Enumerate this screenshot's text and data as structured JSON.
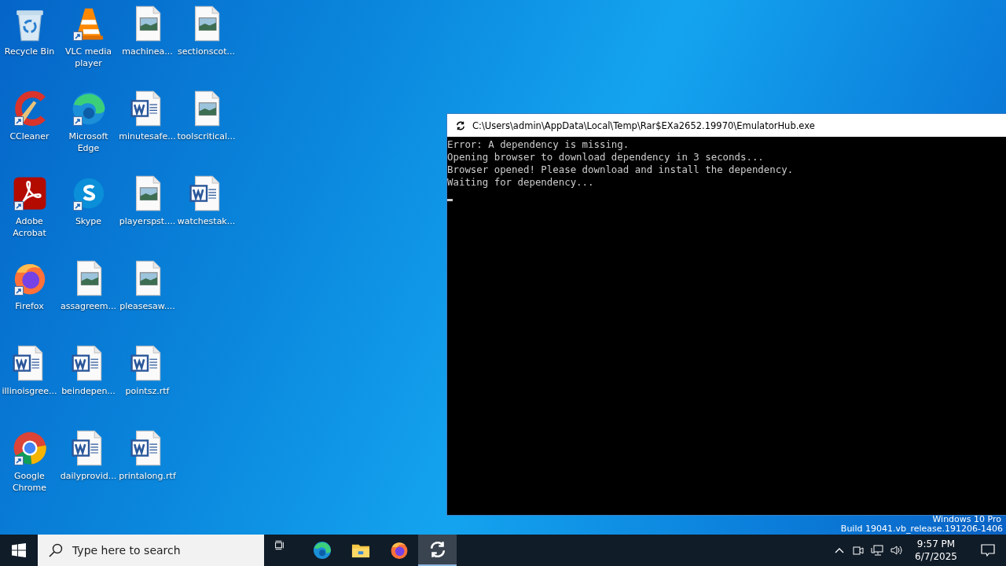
{
  "desktop": {
    "icons": [
      {
        "label": "Recycle Bin",
        "kind": "recycle",
        "shortcut": false
      },
      {
        "label": "CCleaner",
        "kind": "ccleaner",
        "shortcut": true
      },
      {
        "label": "Adobe Acrobat",
        "kind": "acrobat",
        "shortcut": true
      },
      {
        "label": "Firefox",
        "kind": "firefox",
        "shortcut": true
      },
      {
        "label": "illinoisgree...",
        "kind": "word",
        "shortcut": false
      },
      {
        "label": "Google Chrome",
        "kind": "chrome",
        "shortcut": true
      },
      {
        "label": "VLC media player",
        "kind": "vlc",
        "shortcut": true
      },
      {
        "label": "Microsoft Edge",
        "kind": "edge",
        "shortcut": true
      },
      {
        "label": "Skype",
        "kind": "skype",
        "shortcut": true
      },
      {
        "label": "assagreem...",
        "kind": "image",
        "shortcut": false
      },
      {
        "label": "beindepen...",
        "kind": "word",
        "shortcut": false
      },
      {
        "label": "dailyprovid...",
        "kind": "word",
        "shortcut": false
      },
      {
        "label": "machinea...",
        "kind": "image",
        "shortcut": false
      },
      {
        "label": "minutesafe...",
        "kind": "word",
        "shortcut": false
      },
      {
        "label": "playerspst....",
        "kind": "image",
        "shortcut": false
      },
      {
        "label": "pleasesaw....",
        "kind": "image",
        "shortcut": false
      },
      {
        "label": "pointsz.rtf",
        "kind": "word",
        "shortcut": false
      },
      {
        "label": "printalong.rtf",
        "kind": "word",
        "shortcut": false
      },
      {
        "label": "sectionscot...",
        "kind": "image",
        "shortcut": false
      },
      {
        "label": "toolscritical...",
        "kind": "image",
        "shortcut": false
      },
      {
        "label": "watchestak...",
        "kind": "word",
        "shortcut": false
      }
    ],
    "edition": "Windows 10 Pro",
    "build": "Build 19041.vb_release.191206-1406"
  },
  "console": {
    "title": "C:\\Users\\admin\\AppData\\Local\\Temp\\Rar$EXa2652.19970\\EmulatorHub.exe",
    "lines": [
      "Error: A dependency is missing.",
      "Opening browser to download dependency in 3 seconds...",
      "Browser opened! Please download and install the dependency.",
      "Waiting for dependency..."
    ]
  },
  "taskbar": {
    "search": {
      "placeholder": "Type here to search"
    },
    "apps": [
      {
        "kind": "taskview",
        "selected": false
      },
      {
        "kind": "edge",
        "selected": false
      },
      {
        "kind": "explorer",
        "selected": false
      },
      {
        "kind": "firefox",
        "selected": false
      },
      {
        "kind": "console",
        "selected": true
      }
    ],
    "time": "9:57 PM",
    "date": "6/7/2025"
  }
}
